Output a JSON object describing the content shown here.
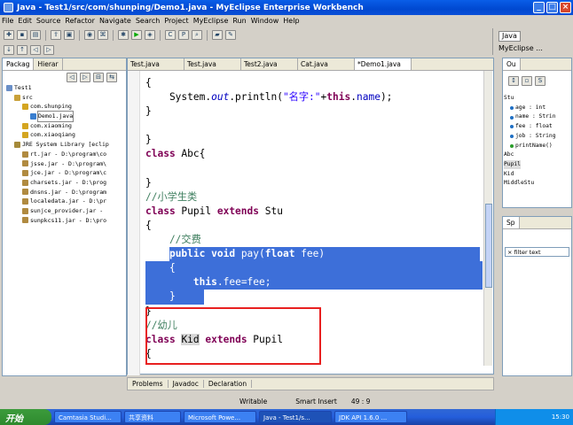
{
  "window": {
    "title": "Java - Test1/src/com/shunping/Demo1.java - MyEclipse Enterprise Workbench"
  },
  "menu": [
    "File",
    "Edit",
    "Source",
    "Refactor",
    "Navigate",
    "Search",
    "Project",
    "MyEclipse",
    "Run",
    "Window",
    "Help"
  ],
  "perspectives": {
    "java": "Java",
    "myeclipse": "MyEclipse ..."
  },
  "left_panel": {
    "tabs": [
      "Packag",
      "Hierar"
    ],
    "tree": [
      {
        "label": "Test1",
        "indent": 0
      },
      {
        "label": "src",
        "indent": 1
      },
      {
        "label": "com.shunping",
        "indent": 2
      },
      {
        "label": "Demo1.java",
        "indent": 3
      },
      {
        "label": "com.xiaoming",
        "indent": 2
      },
      {
        "label": "com.xiaoqiang",
        "indent": 2
      },
      {
        "label": "JRE System Library [eclip",
        "indent": 1
      },
      {
        "label": "rt.jar - D:\\program\\co",
        "indent": 2
      },
      {
        "label": "jsse.jar - D:\\program\\",
        "indent": 2
      },
      {
        "label": "jce.jar - D:\\program\\c",
        "indent": 2
      },
      {
        "label": "charsets.jar - D:\\prog",
        "indent": 2
      },
      {
        "label": "dnsns.jar - D:\\program",
        "indent": 2
      },
      {
        "label": "localedata.jar - D:\\pr",
        "indent": 2
      },
      {
        "label": "sunjce_provider.jar - ",
        "indent": 2
      },
      {
        "label": "sunpkcs11.jar - D:\\pro",
        "indent": 2
      }
    ]
  },
  "editor": {
    "tabs": [
      "Test.java",
      "Test.java",
      "Test2.java",
      "Cat.java",
      "*Demo1.java"
    ],
    "code": {
      "l1": "{",
      "l2_pre": "    System.",
      "l2_out": "out",
      "l2_mid": ".println(",
      "l2_str": "\"名字:\"",
      "l2_plus": "+",
      "l2_this": "this",
      "l2_dot": ".",
      "l2_name": "name",
      "l2_end": ");",
      "l3": "}",
      "l5": "}",
      "l6_kw": "class",
      "l6_rest": " Abc{",
      "l8": "}",
      "l9": "//小学生类",
      "l10_kw1": "class",
      "l10_mid": " Pupil ",
      "l10_kw2": "extends",
      "l10_end": " Stu",
      "l11": "{",
      "l12": "    //交费",
      "l13_pre": "    ",
      "l13_kw1": "public",
      "l13_kw2": "void",
      "l13_rest": " pay(",
      "l13_kw3": "float",
      "l13_end": " fee)",
      "l14": "    {",
      "l15_pre": "        ",
      "l15_kw": "this",
      "l15_dot": ".",
      "l15_fee": "fee",
      "l15_end": "=fee;",
      "l16": "    }",
      "l17": "}",
      "l18": "//幼儿",
      "l19_kw1": "class",
      "l19_sp": " ",
      "l19_kid": "Kid",
      "l19_sp2": " ",
      "l19_kw2": "extends",
      "l19_end": " Pupil",
      "l20": "{",
      "l22": "}"
    }
  },
  "outline": {
    "tab": "Ou",
    "items": [
      "Stu",
      "age : int",
      "name : Strin",
      "fee : float",
      "job : String",
      "printName()",
      "Abc",
      "Pupil",
      "Kid",
      "MiddleStu"
    ]
  },
  "sp_panel": {
    "tab": "Sp",
    "filter": "× filter text"
  },
  "bottom_tabs": [
    "Problems",
    "Javadoc",
    "Declaration"
  ],
  "status": {
    "writable": "Writable",
    "insert": "Smart Insert",
    "position": "49 : 9"
  },
  "taskbar": {
    "start": "开始",
    "tasks": [
      "Camtasia Studi...",
      "共享资料",
      "Microsoft Powe...",
      "Java - Test1/s...",
      "JDK API 1.6.0 ..."
    ],
    "clock": "15:30"
  }
}
